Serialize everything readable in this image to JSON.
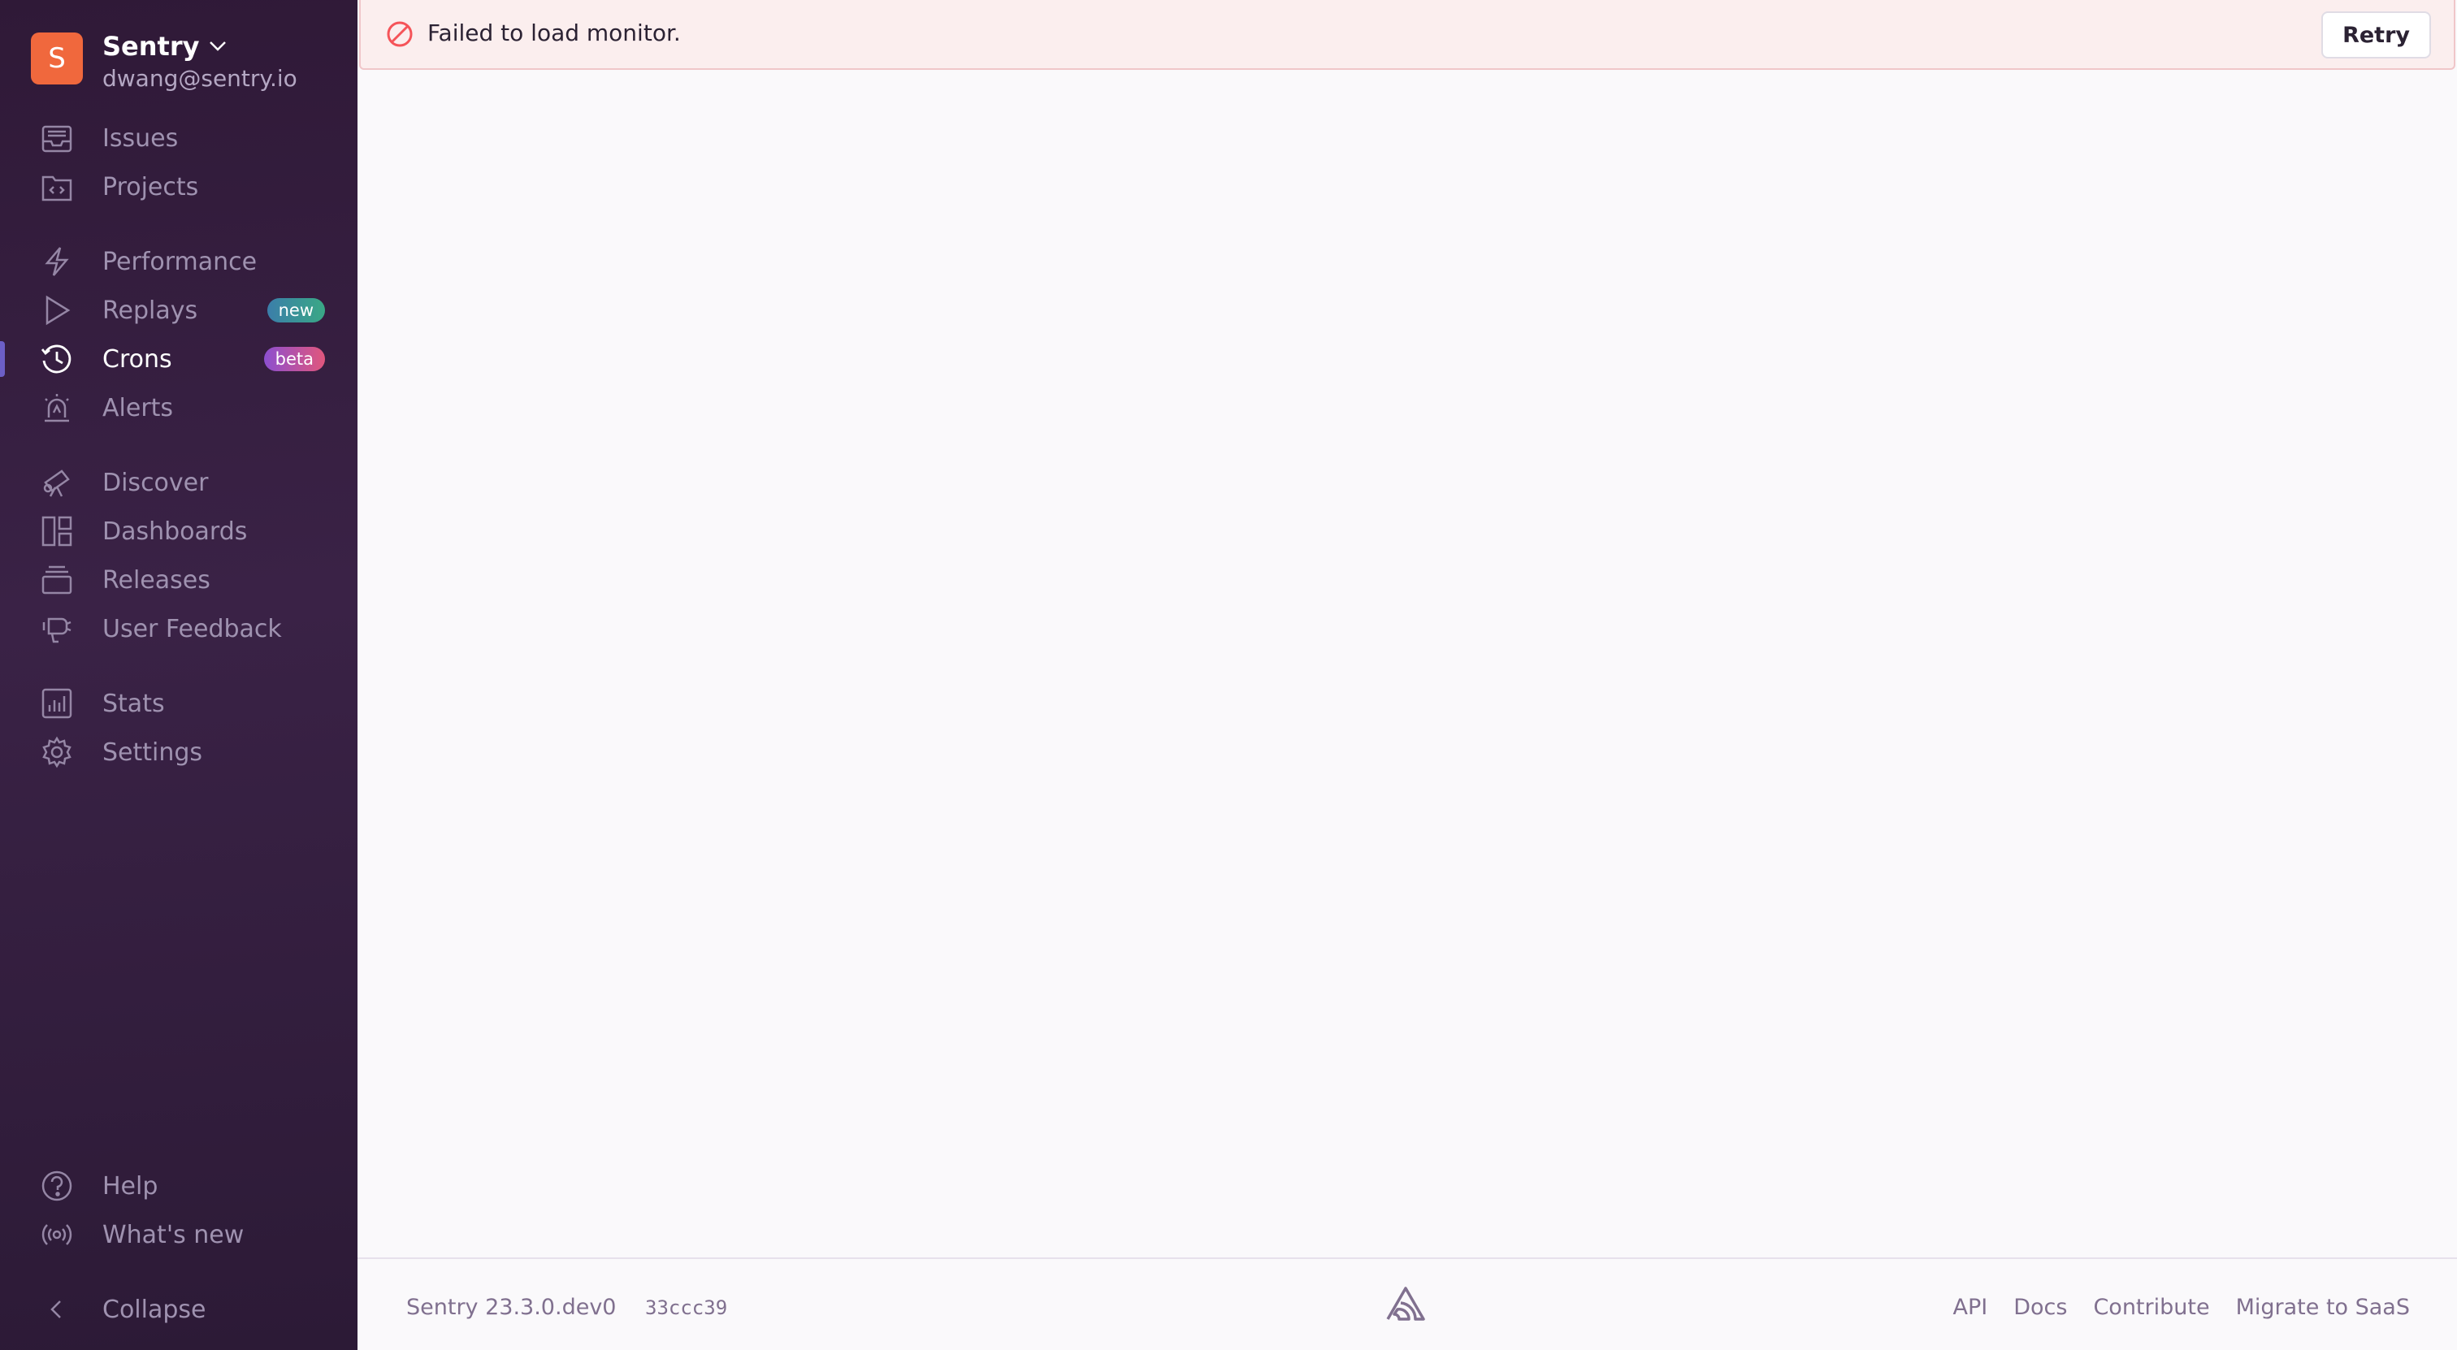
{
  "org": {
    "initial": "S",
    "name": "Sentry",
    "email": "dwang@sentry.io"
  },
  "nav": {
    "issues": "Issues",
    "projects": "Projects",
    "performance": "Performance",
    "replays": "Replays",
    "replays_badge": "new",
    "crons": "Crons",
    "crons_badge": "beta",
    "alerts": "Alerts",
    "discover": "Discover",
    "dashboards": "Dashboards",
    "releases": "Releases",
    "user_feedback": "User Feedback",
    "stats": "Stats",
    "settings": "Settings",
    "help": "Help",
    "whats_new": "What's new",
    "collapse": "Collapse"
  },
  "alert": {
    "message": "Failed to load monitor.",
    "retry_label": "Retry"
  },
  "footer": {
    "version": "Sentry 23.3.0.dev0",
    "hash": "33ccc39",
    "links": [
      "API",
      "Docs",
      "Contribute",
      "Migrate to SaaS"
    ]
  },
  "colors": {
    "sidebar_bg": "#2f1937",
    "accent": "#6c5fc7",
    "error": "#f55459",
    "org_avatar": "#f0683d"
  }
}
